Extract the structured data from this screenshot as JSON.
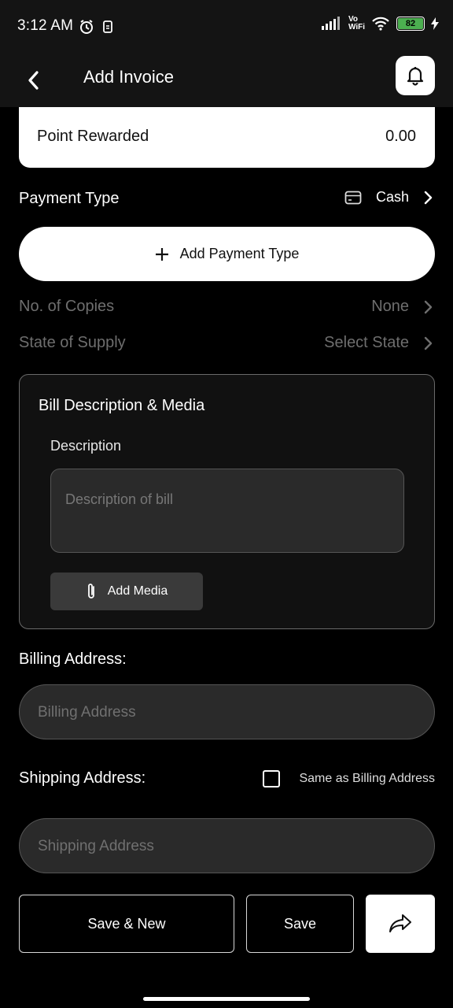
{
  "status_bar": {
    "time": "3:12 AM",
    "network": "Vo WiFi",
    "battery": "82",
    "icons": [
      "alarm-icon",
      "usb-icon",
      "signal-icon",
      "wifi-icon",
      "battery-icon",
      "charging-icon"
    ]
  },
  "header": {
    "title": "Add Invoice",
    "back_icon": "chevron-left-icon",
    "bell_icon": "bell-icon"
  },
  "points": {
    "label": "Point Rewarded",
    "value": "0.00"
  },
  "payment": {
    "label": "Payment Type",
    "value": "Cash",
    "icon": "card-icon",
    "add_button": "Add Payment Type"
  },
  "copies": {
    "label": "No. of Copies",
    "value": "None"
  },
  "supply": {
    "label": "State of Supply",
    "value": "Select State"
  },
  "bill": {
    "title": "Bill Description & Media",
    "description_label": "Description",
    "description_placeholder": "Description of bill",
    "add_media": "Add Media"
  },
  "billing": {
    "label": "Billing Address:",
    "placeholder": "Billing Address"
  },
  "shipping": {
    "label": "Shipping Address:",
    "same_as_billing": "Same as Billing Address",
    "same_checked": false,
    "placeholder": "Shipping Address"
  },
  "actions": {
    "save_new": "Save & New",
    "save": "Save",
    "share_icon": "share-icon"
  },
  "colors": {
    "background": "#000000",
    "header": "#141414",
    "card": "#ffffff",
    "input": "#2a2a2a",
    "muted": "#6e6e6e"
  }
}
